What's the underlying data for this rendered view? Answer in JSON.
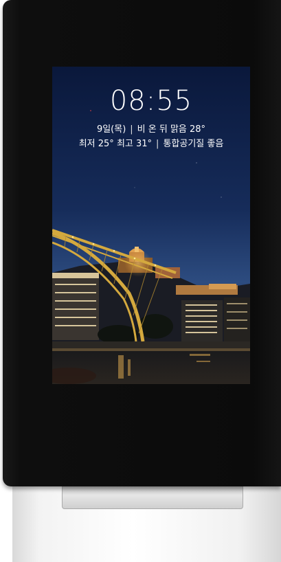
{
  "lock_screen": {
    "time": "08:55",
    "date": "9일(목)",
    "weather": "비 온 뒤 맑음 28°",
    "temp_low": "최저 25°",
    "temp_high": "최고 31°",
    "air_quality": "통합공기질 좋음",
    "separator": "|"
  },
  "wallpaper": {
    "description_icon": "city-bridge-night-photo"
  },
  "colors": {
    "device_body": "#0b0b0b",
    "sky_top": "#0b1a3d",
    "sky_bottom": "#24406f",
    "bridge": "#c9a23a",
    "text": "#ffffff"
  }
}
